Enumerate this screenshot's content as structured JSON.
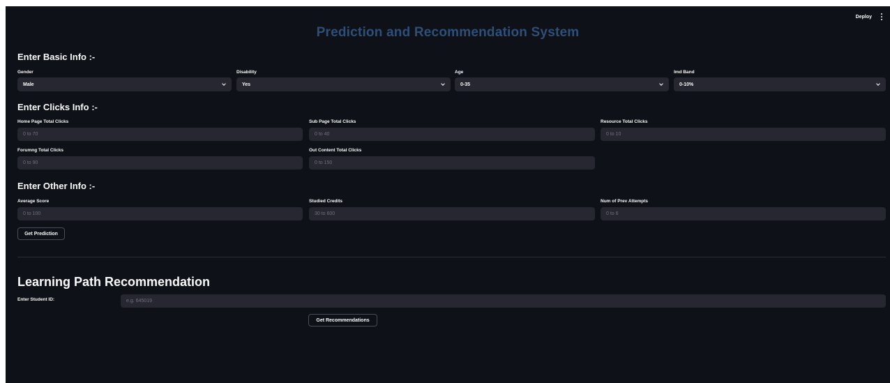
{
  "topbar": {
    "deploy_label": "Deploy"
  },
  "title": "Prediction and Recommendation System",
  "basic": {
    "heading": "Enter Basic Info :-",
    "gender": {
      "label": "Gender",
      "value": "Male"
    },
    "disability": {
      "label": "Disability",
      "value": "Yes"
    },
    "age": {
      "label": "Age",
      "value": "0-35"
    },
    "imd": {
      "label": "Imd Band",
      "value": "0-10%"
    }
  },
  "clicks": {
    "heading": "Enter Clicks Info :-",
    "home": {
      "label": "Home Page Total Clicks",
      "placeholder": "0 to 70"
    },
    "sub": {
      "label": "Sub Page Total Clicks",
      "placeholder": "0 to 40"
    },
    "resource": {
      "label": "Resource Total Clicks",
      "placeholder": "0 to 10"
    },
    "forum": {
      "label": "Forumng Total Clicks",
      "placeholder": "0 to 90"
    },
    "outcontent": {
      "label": "Out Content Total Clicks",
      "placeholder": "0 to 150"
    }
  },
  "other": {
    "heading": "Enter Other Info :-",
    "avg": {
      "label": "Average Score",
      "placeholder": "0 to 100"
    },
    "credits": {
      "label": "Studied Credits",
      "placeholder": "30 to 600"
    },
    "attempts": {
      "label": "Num of Prev Attempts",
      "placeholder": "0 to 6"
    }
  },
  "predict_button": "Get Prediction",
  "recommend": {
    "heading": "Learning Path Recommendation",
    "student_label": "Enter Student ID:",
    "student_placeholder": "e.g. 645019",
    "button": "Get Recommendations"
  }
}
